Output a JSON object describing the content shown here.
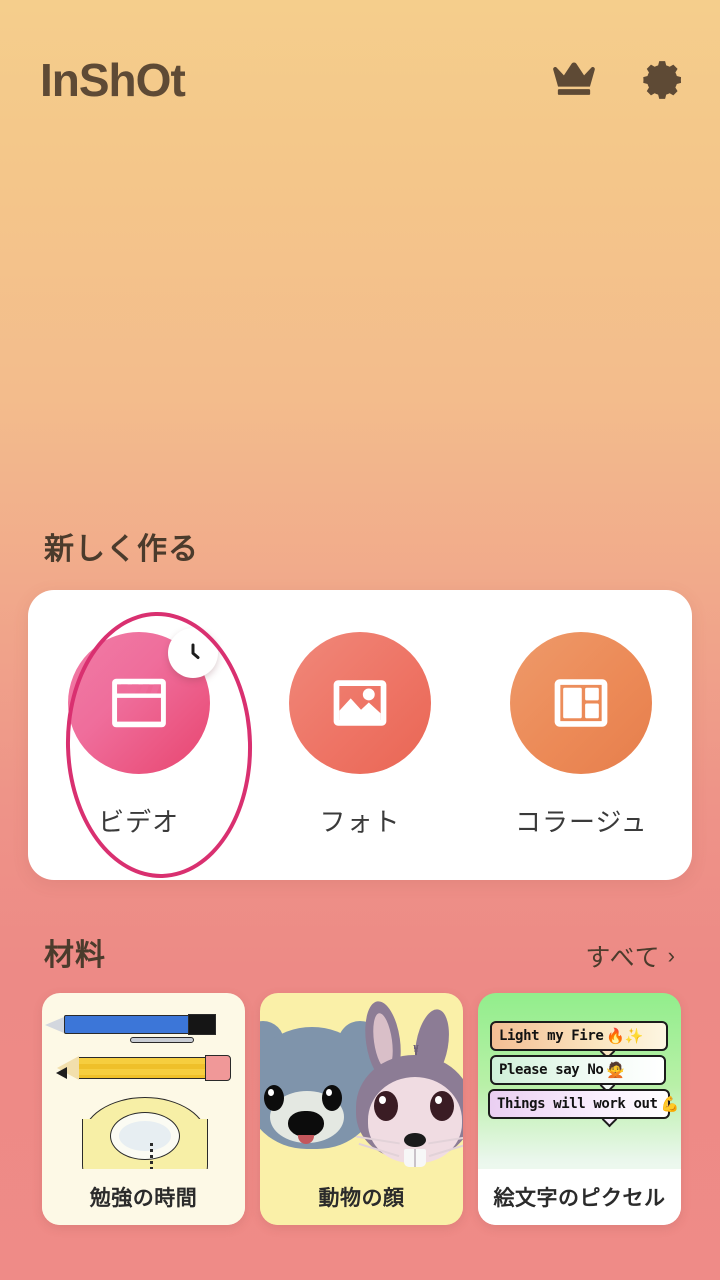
{
  "app": {
    "logo_text": "InShOt",
    "logo_color": "#5E4A35",
    "background_top_color": "#F5CE8C",
    "background_bottom_color": "#EF8B87"
  },
  "topbar": {
    "pro_icon": "crown-icon",
    "settings_icon": "gear-icon"
  },
  "create_section": {
    "title": "新しく作る",
    "items": [
      {
        "label": "ビデオ",
        "icon": "clapperboard-icon",
        "color": "#EF6D9B",
        "badge": "clock-icon",
        "highlighted": true
      },
      {
        "label": "フォト",
        "icon": "image-icon",
        "color": "#EE7465",
        "badge": "",
        "highlighted": false
      },
      {
        "label": "コラージュ",
        "icon": "collage-grid-icon",
        "color": "#EC8A57",
        "badge": "",
        "highlighted": false
      }
    ]
  },
  "materials_section": {
    "title": "材料",
    "see_all_label": "すべて",
    "see_all_chevron": "›",
    "cards": [
      {
        "label": "勉強の時間",
        "background_color": "#FDF9E6",
        "art": "stationery-pen-pencil-tape"
      },
      {
        "label": "動物の顔",
        "background_color": "#FAF0A8",
        "art": "bear-and-rabbit-faces"
      },
      {
        "label": "絵文字のピクセル",
        "background_color": "#92EE8C",
        "art": "pixel-speech-bubbles",
        "bubbles": [
          {
            "text": "Light my Fire",
            "emoji": "🔥✨"
          },
          {
            "text": "Please say No",
            "emoji": "🙅"
          },
          {
            "text": "Things will work out",
            "emoji": "💪"
          }
        ]
      }
    ]
  },
  "annotation": {
    "type": "ellipse-highlight",
    "color": "#D93070",
    "target": "ビデオ"
  }
}
